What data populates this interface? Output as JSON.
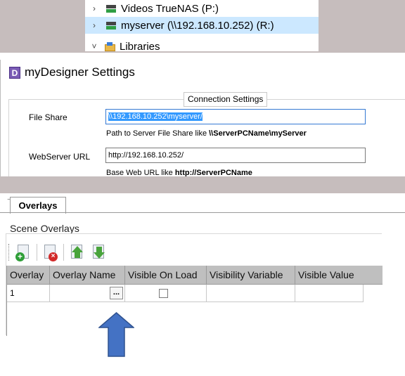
{
  "explorer": {
    "items": [
      {
        "label": "Videos TrueNAS (P:)",
        "chevron": "›",
        "icon": "network-drive-icon"
      },
      {
        "label": "myserver (\\\\192.168.10.252) (R:)",
        "chevron": "›",
        "icon": "network-drive-icon"
      },
      {
        "label": "Libraries",
        "chevron": "˅",
        "icon": "libraries-icon"
      }
    ]
  },
  "settings": {
    "app_icon_letter": "D",
    "title": "myDesigner Settings",
    "group_caption": "Connection Settings",
    "file_share": {
      "label": "File Share",
      "value": "\\\\192.168.10.252\\myserver/",
      "hint_prefix": "Path to Server File Share like ",
      "hint_example": "\\\\ServerPCName\\myServer"
    },
    "webserver": {
      "label": "WebServer URL",
      "value": "http://192.168.10.252/",
      "hint_prefix": "Base Web URL like ",
      "hint_example": "http://ServerPCName"
    }
  },
  "overlays": {
    "tab_label": "Overlays",
    "section_title": "Scene Overlays",
    "toolbar": [
      "add-overlay-icon",
      "delete-overlay-icon",
      "move-up-icon",
      "move-down-icon"
    ],
    "columns": [
      "Overlay",
      "Overlay Name",
      "Visible On Load",
      "Visibility Variable",
      "Visible Value"
    ],
    "rows": [
      {
        "overlay": "1",
        "name": "",
        "visible_on_load": false,
        "visibility_variable": "",
        "visible_value": ""
      }
    ],
    "ellipsis_label": "..."
  },
  "colors": {
    "selection": "#cce8ff",
    "accent": "#3579d3",
    "pointer_arrow": "#4472c4"
  }
}
